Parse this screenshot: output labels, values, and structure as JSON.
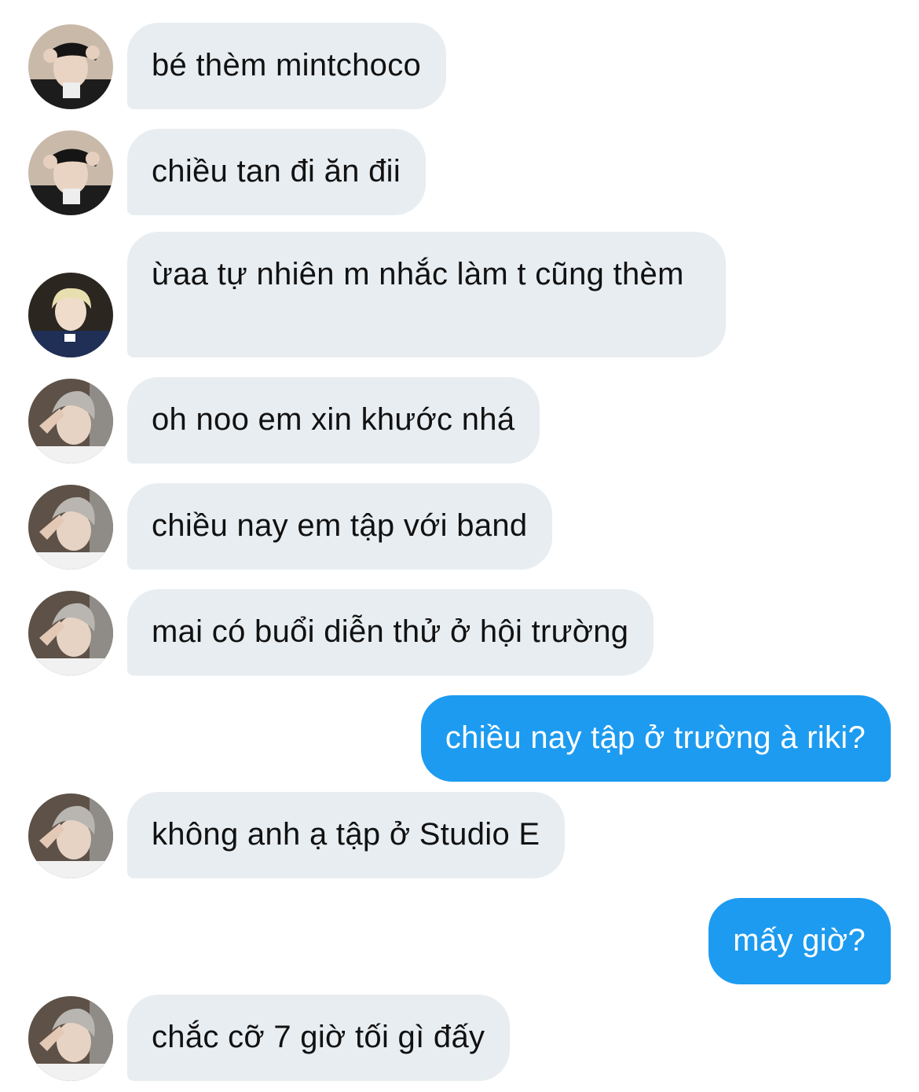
{
  "theme": {
    "incoming_bubble": "#e8edf1",
    "outgoing_bubble": "#1d9bf0"
  },
  "messages": [
    {
      "text": "bé thèm mintchoco",
      "avatar": "avatar-black-cap-icon"
    },
    {
      "text": "chiều tan đi ăn đii",
      "avatar": "avatar-black-cap-icon"
    },
    {
      "text": "ừaa tự nhiên m nhắc làm t cũng thèm",
      "avatar": "avatar-blond-hair-icon"
    },
    {
      "text": "oh noo em xin khước nhá",
      "avatar": "avatar-silver-hair-icon"
    },
    {
      "text": "chiều nay em tập với band",
      "avatar": "avatar-silver-hair-icon"
    },
    {
      "text": "mai có buổi diễn thử ở hội trường",
      "avatar": "avatar-silver-hair-icon"
    },
    {
      "text": "chiều nay tập ở trường à riki?"
    },
    {
      "text": "không anh ạ tập ở Studio E",
      "avatar": "avatar-silver-hair-icon"
    },
    {
      "text": "mấy giờ?"
    },
    {
      "text": "chắc cỡ 7 giờ tối gì đấy",
      "avatar": "avatar-silver-hair-icon"
    }
  ]
}
